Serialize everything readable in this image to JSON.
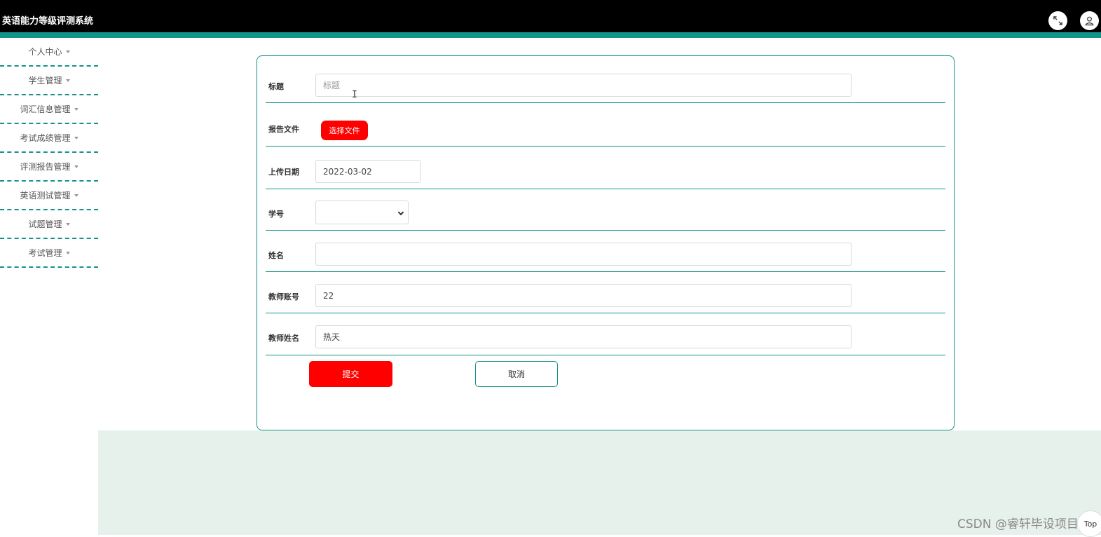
{
  "header": {
    "title": "英语能力等级评测系统",
    "icons": {
      "fullscreen": "fullscreen-icon",
      "user": "user-icon"
    }
  },
  "sidebar": {
    "items": [
      {
        "label": "个人中心"
      },
      {
        "label": "学生管理"
      },
      {
        "label": "词汇信息管理"
      },
      {
        "label": "考试成绩管理"
      },
      {
        "label": "评测报告管理"
      },
      {
        "label": "英语测试管理"
      },
      {
        "label": "试题管理"
      },
      {
        "label": "考试管理"
      }
    ]
  },
  "form": {
    "title": {
      "label": "标题",
      "placeholder": "标题",
      "value": ""
    },
    "report_file": {
      "label": "报告文件",
      "button": "选择文件"
    },
    "upload_date": {
      "label": "上传日期",
      "value": "2022-03-02"
    },
    "student_no": {
      "label": "学号",
      "value": ""
    },
    "name": {
      "label": "姓名",
      "value": ""
    },
    "teacher_account": {
      "label": "教师账号",
      "value": "22"
    },
    "teacher_name": {
      "label": "教师姓名",
      "value": "热天"
    },
    "submit": "提交",
    "cancel": "取消"
  },
  "footer": {
    "watermark": "CSDN @睿轩毕设项目",
    "corner_button": "Top"
  },
  "colors": {
    "accent": "#14938a",
    "primary_button": "#ff0000",
    "header_bg": "#000000",
    "bottom_bg": "#e7f1ec"
  }
}
